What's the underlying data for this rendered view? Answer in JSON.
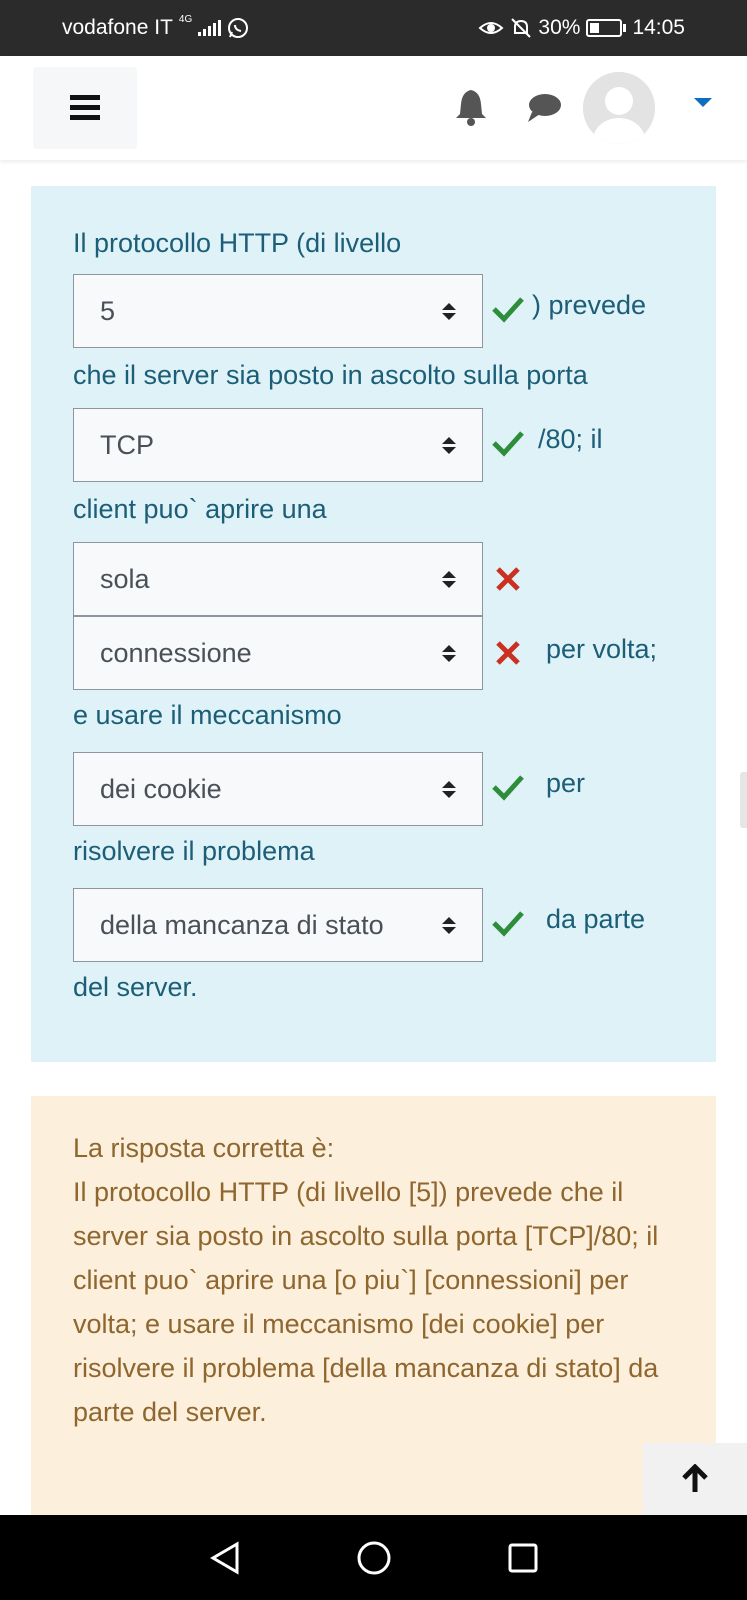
{
  "status_bar": {
    "carrier": "vodafone IT",
    "network_type": "4G",
    "battery": "30%",
    "time": "14:05"
  },
  "header": {
    "menu_icon": "hamburger-icon",
    "notification_icon": "bell-icon",
    "messages_icon": "chat-icon",
    "avatar_icon": "user-avatar",
    "dropdown_icon": "caret-down-icon",
    "accent_color": "#0f6cbf"
  },
  "question": {
    "background_color": "#def2f8",
    "text_color": "#1c5e77",
    "lines": [
      {
        "text": "Il protocollo  HTTP  (di livello"
      },
      {
        "select": "5",
        "result": "correct",
        "after": ") prevede"
      },
      {
        "text": "che il server sia posto in ascolto sulla porta"
      },
      {
        "select": "TCP",
        "result": "correct",
        "after": "/80; il"
      },
      {
        "text": "client puo` aprire una"
      },
      {
        "select": "sola",
        "result": "incorrect",
        "after": ""
      },
      {
        "select": "connessione",
        "result": "incorrect",
        "after": "per volta;"
      },
      {
        "text": "e usare il meccanismo"
      },
      {
        "select": "dei cookie",
        "result": "correct",
        "after": "per"
      },
      {
        "text": "risolvere il problema"
      },
      {
        "select": "della mancanza di stato",
        "result": "correct",
        "after": "da parte"
      },
      {
        "text": "del server."
      }
    ]
  },
  "feedback": {
    "background_color": "#fcefdc",
    "text_color": "#8e662e",
    "heading": "La risposta corretta è:",
    "body": "Il protocollo  HTTP  (di livello [5]) prevede che il server sia posto in ascolto sulla porta [TCP]/80; il client puo` aprire una [o piu`] [connessioni] per volta; e usare il meccanismo [dei cookie] per risolvere il problema [della mancanza di stato] da parte del server."
  },
  "back_to_top_icon": "arrow-up-icon",
  "nav_bar": {
    "back_icon": "back-triangle-icon",
    "home_icon": "home-circle-icon",
    "recents_icon": "recents-square-icon"
  }
}
